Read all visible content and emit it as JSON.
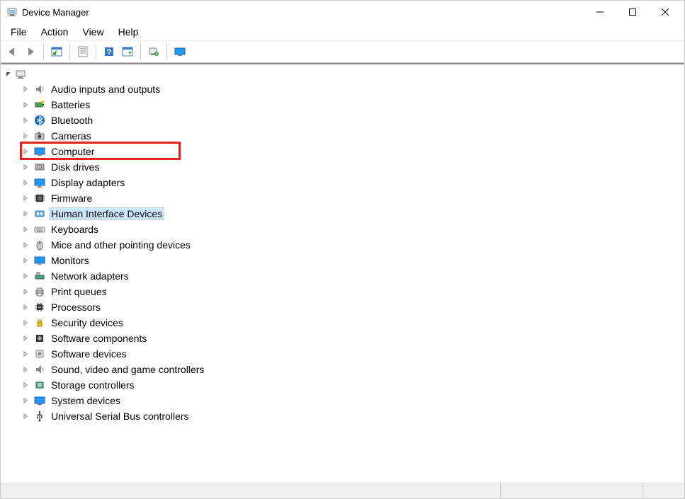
{
  "window": {
    "title": "Device Manager"
  },
  "menu": {
    "items": [
      "File",
      "Action",
      "View",
      "Help"
    ]
  },
  "toolbar": {
    "back": "Back",
    "forward": "Forward",
    "show_hide": "Show/Hide Console Tree",
    "properties": "Properties",
    "help": "Help",
    "action": "Action",
    "scan": "Scan for hardware changes",
    "monitor": "Add legacy hardware"
  },
  "tree": {
    "root_icon": "computer",
    "items": [
      {
        "label": "Audio inputs and outputs",
        "icon": "audio-icon",
        "selected": false
      },
      {
        "label": "Batteries",
        "icon": "battery-icon",
        "selected": false
      },
      {
        "label": "Bluetooth",
        "icon": "bluetooth-icon",
        "selected": false
      },
      {
        "label": "Cameras",
        "icon": "camera-icon",
        "selected": false
      },
      {
        "label": "Computer",
        "icon": "computer-icon",
        "selected": false
      },
      {
        "label": "Disk drives",
        "icon": "disk-icon",
        "selected": false
      },
      {
        "label": "Display adapters",
        "icon": "display-icon",
        "selected": false
      },
      {
        "label": "Firmware",
        "icon": "firmware-icon",
        "selected": false
      },
      {
        "label": "Human Interface Devices",
        "icon": "hid-icon",
        "selected": true,
        "highlighted": true
      },
      {
        "label": "Keyboards",
        "icon": "keyboard-icon",
        "selected": false
      },
      {
        "label": "Mice and other pointing devices",
        "icon": "mouse-icon",
        "selected": false
      },
      {
        "label": "Monitors",
        "icon": "monitor-icon",
        "selected": false
      },
      {
        "label": "Network adapters",
        "icon": "network-icon",
        "selected": false
      },
      {
        "label": "Print queues",
        "icon": "printer-icon",
        "selected": false
      },
      {
        "label": "Processors",
        "icon": "cpu-icon",
        "selected": false
      },
      {
        "label": "Security devices",
        "icon": "security-icon",
        "selected": false
      },
      {
        "label": "Software components",
        "icon": "software-comp-icon",
        "selected": false
      },
      {
        "label": "Software devices",
        "icon": "software-dev-icon",
        "selected": false
      },
      {
        "label": "Sound, video and game controllers",
        "icon": "sound-icon",
        "selected": false
      },
      {
        "label": "Storage controllers",
        "icon": "storage-icon",
        "selected": false
      },
      {
        "label": "System devices",
        "icon": "system-icon",
        "selected": false
      },
      {
        "label": "Universal Serial Bus controllers",
        "icon": "usb-icon",
        "selected": false
      }
    ]
  }
}
